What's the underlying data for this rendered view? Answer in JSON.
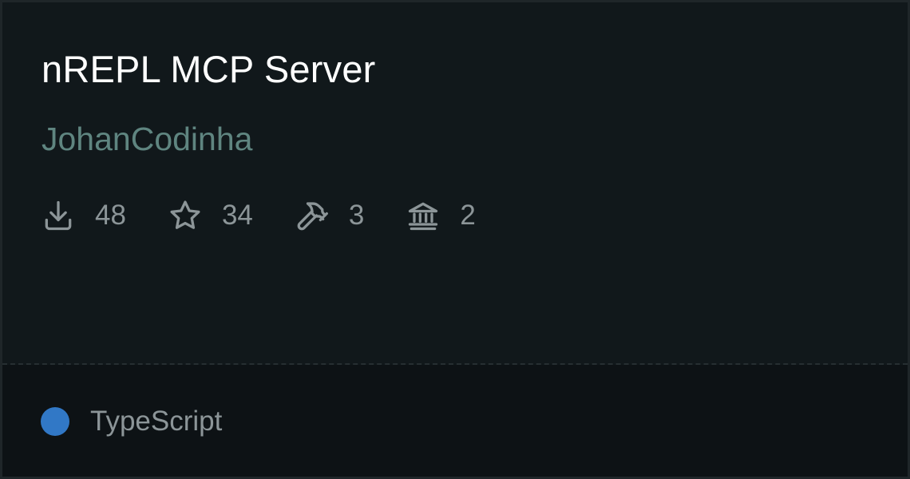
{
  "card": {
    "title": "nREPL MCP Server",
    "author": "JohanCodinha",
    "stats": [
      {
        "icon": "download-icon",
        "value": "48"
      },
      {
        "icon": "star-icon",
        "value": "34"
      },
      {
        "icon": "hammer-icon",
        "value": "3"
      },
      {
        "icon": "bank-icon",
        "value": "2"
      }
    ],
    "language": {
      "label": "TypeScript",
      "color": "#3178c6"
    }
  }
}
